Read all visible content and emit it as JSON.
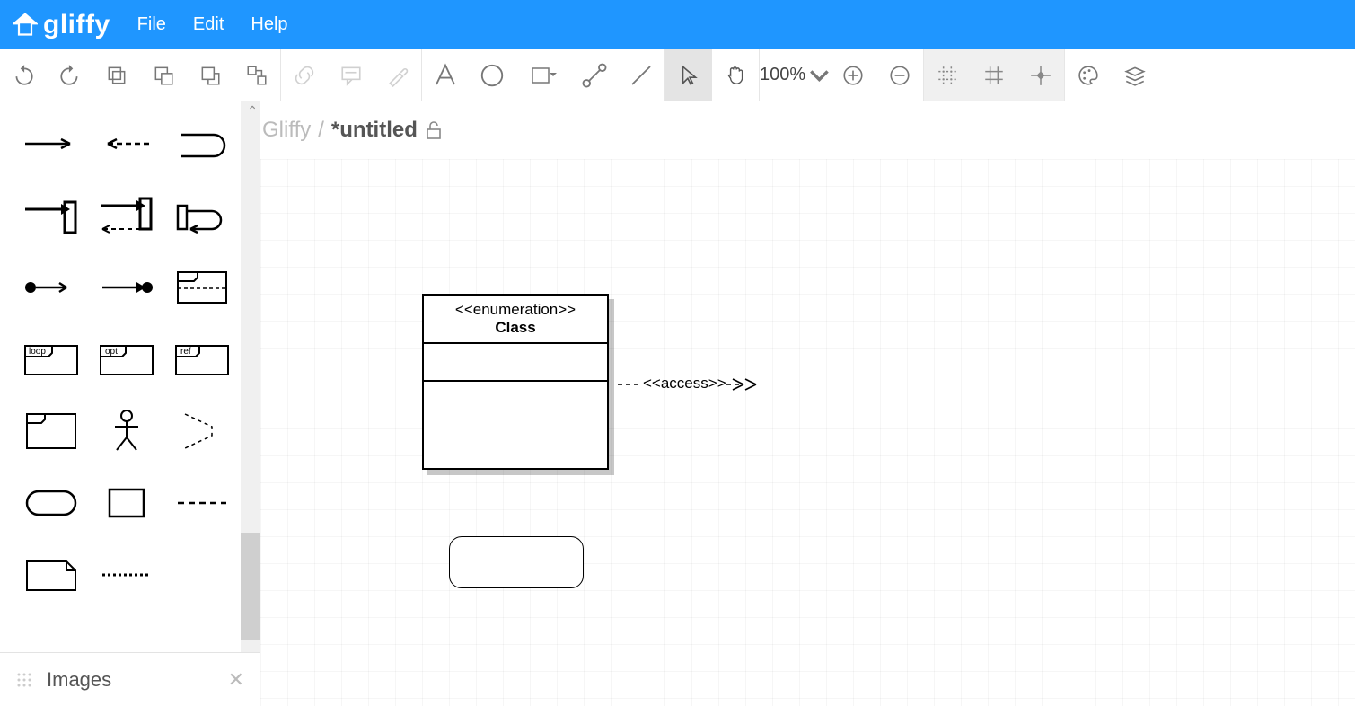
{
  "app": {
    "name": "gliffy"
  },
  "menu": {
    "file": "File",
    "edit": "Edit",
    "help": "Help"
  },
  "toolbar": {
    "zoom": "100%"
  },
  "doc": {
    "breadcrumb_root": "Gliffy",
    "breadcrumb_sep": "/",
    "filename": "*untitled"
  },
  "sidebar": {
    "images_panel_label": "Images",
    "stencil_labels": {
      "loop": "loop",
      "opt": "opt",
      "ref": "ref"
    }
  },
  "canvas": {
    "uml_class": {
      "stereotype": "<<enumeration>>",
      "name": "Class"
    },
    "connector_label": "<<access>>"
  }
}
